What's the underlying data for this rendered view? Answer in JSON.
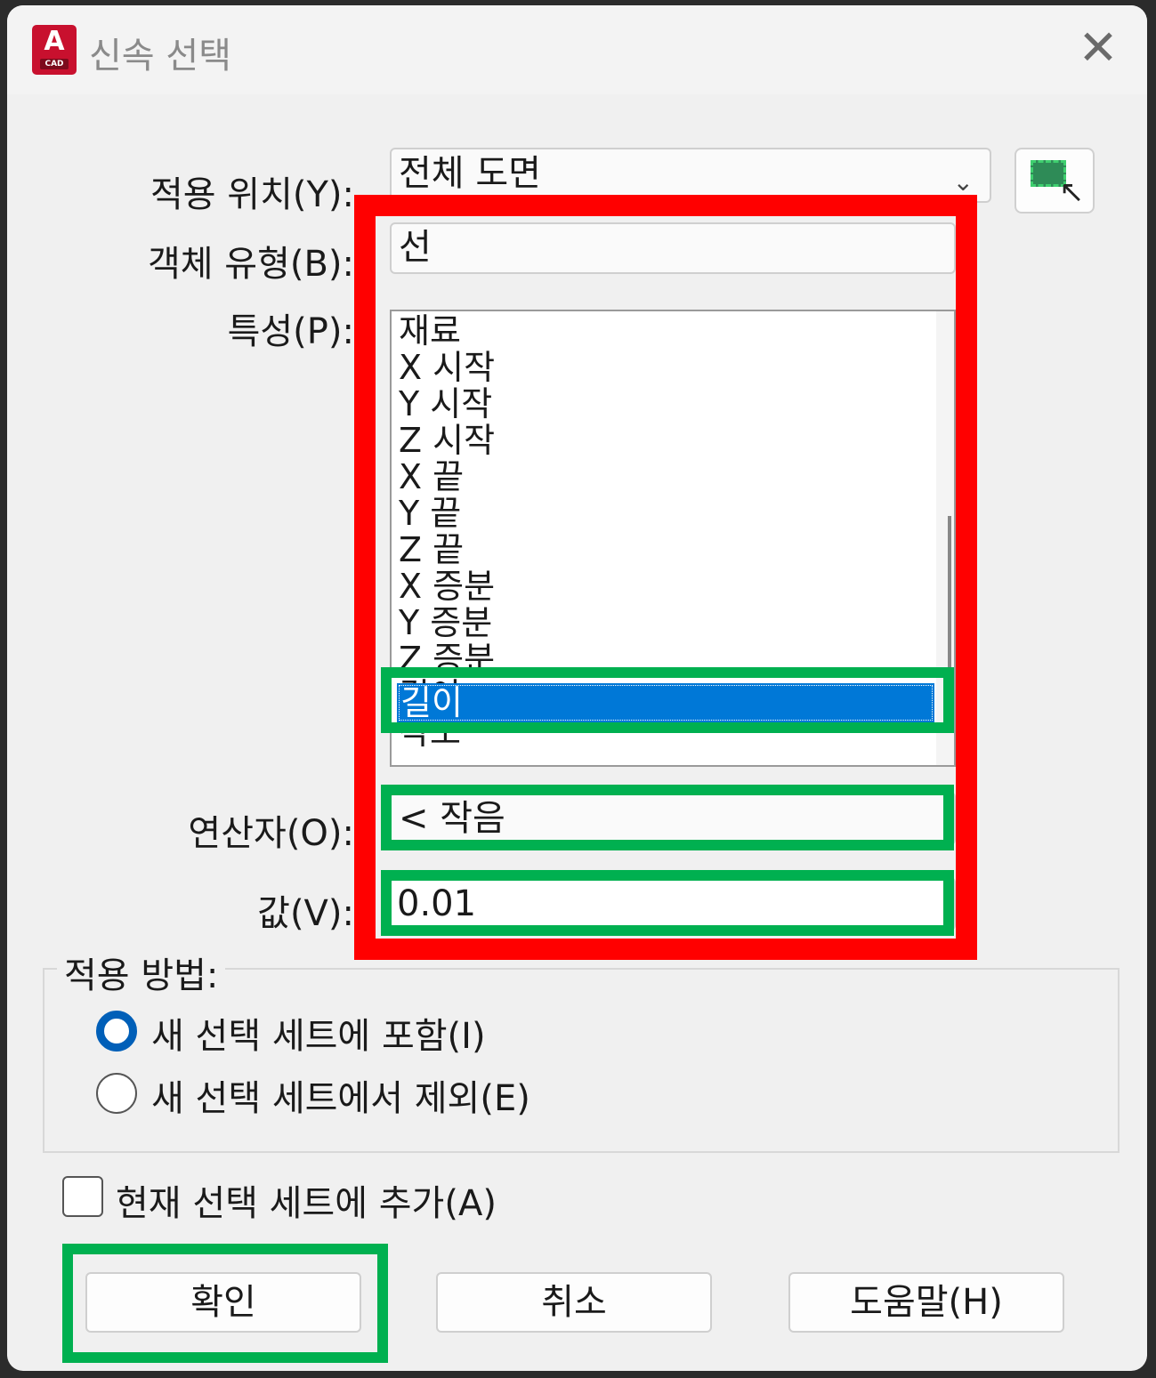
{
  "window": {
    "title": "신속 선택",
    "app_icon_letter": "A",
    "app_icon_caption": "CAD",
    "close_glyph": "✕"
  },
  "apply_to": {
    "label": "적용 위치(Y):",
    "value": "전체 도면"
  },
  "object_type": {
    "label": "객체 유형(B):",
    "value": "선"
  },
  "properties": {
    "label": "특성(P):",
    "items": [
      "재료",
      "X 시작",
      "Y 시작",
      "Z 시작",
      "X 끝",
      "Y 끝",
      "Z 끝",
      "X 증분",
      "Y 증분",
      "Z 증분",
      "길이",
      "각도"
    ],
    "selected": "길이"
  },
  "operator": {
    "label": "연산자(O):",
    "value": "< 작음"
  },
  "value": {
    "label": "값(V):",
    "value": "0.01"
  },
  "how_to_apply": {
    "title": "적용 방법:",
    "option_include": "새 선택 세트에 포함(I)",
    "option_exclude": "새 선택 세트에서 제외(E)",
    "selected": "include"
  },
  "append": {
    "label": "현재 선택 세트에 추가(A)",
    "checked": false
  },
  "buttons": {
    "ok": "확인",
    "cancel": "취소",
    "help": "도움말(H)"
  },
  "colors": {
    "highlight_red": "#ff0000",
    "highlight_green": "#00b050",
    "selection_blue": "#0078d7"
  },
  "icons": {
    "chevron": "chevron-down-icon",
    "select_objects": "select-objects-icon"
  }
}
